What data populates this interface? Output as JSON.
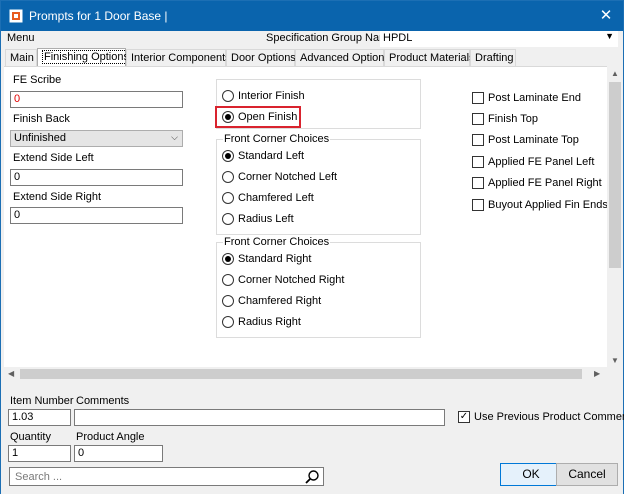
{
  "window": {
    "title": "Prompts for 1 Door Base |"
  },
  "menu": {
    "label": "Menu",
    "spec_label": "Specification Group Name",
    "spec_value": "HPDL"
  },
  "tabs": [
    {
      "label": "Main"
    },
    {
      "label": "Finishing Options"
    },
    {
      "label": "Interior Components"
    },
    {
      "label": "Door Options"
    },
    {
      "label": "Advanced Options"
    },
    {
      "label": "Product Materials"
    },
    {
      "label": "Drafting"
    }
  ],
  "left": {
    "fe_scribe_label": "FE Scribe",
    "fe_scribe_value": "0",
    "finish_back_label": "Finish Back",
    "finish_back_value": "Unfinished",
    "extend_left_label": "Extend Side Left",
    "extend_left_value": "0",
    "extend_right_label": "Extend Side Right",
    "extend_right_value": "0"
  },
  "finish": {
    "interior": "Interior Finish",
    "open": "Open Finish",
    "selected": "open"
  },
  "front_left": {
    "title": "Front Corner Choices",
    "options": [
      "Standard Left",
      "Corner Notched Left",
      "Chamfered Left",
      "Radius Left"
    ],
    "selected": 0
  },
  "front_right": {
    "title": "Front Corner Choices",
    "options": [
      "Standard Right",
      "Corner Notched Right",
      "Chamfered Right",
      "Radius Right"
    ],
    "selected": 0
  },
  "checks": [
    {
      "label": "Post Laminate End",
      "checked": false
    },
    {
      "label": "Finish Top",
      "checked": false
    },
    {
      "label": "Post Laminate Top",
      "checked": false
    },
    {
      "label": "Applied FE Panel Left",
      "checked": false
    },
    {
      "label": "Applied FE Panel Right",
      "checked": false
    },
    {
      "label": "Buyout Applied Fin Ends",
      "checked": false
    }
  ],
  "bottom": {
    "item_number_label": "Item Number",
    "item_number_value": "1.03",
    "comments_label": "Comments",
    "comments_value": "",
    "use_prev_label": "Use Previous Product Comments",
    "use_prev_checked": true,
    "quantity_label": "Quantity",
    "quantity_value": "1",
    "angle_label": "Product Angle",
    "angle_value": "0",
    "search_placeholder": "Search ...",
    "ok_label": "OK",
    "cancel_label": "Cancel"
  },
  "colors": {
    "titlebar": "#0a64ad",
    "highlight": "#d9232e",
    "error_text": "#e00000"
  }
}
